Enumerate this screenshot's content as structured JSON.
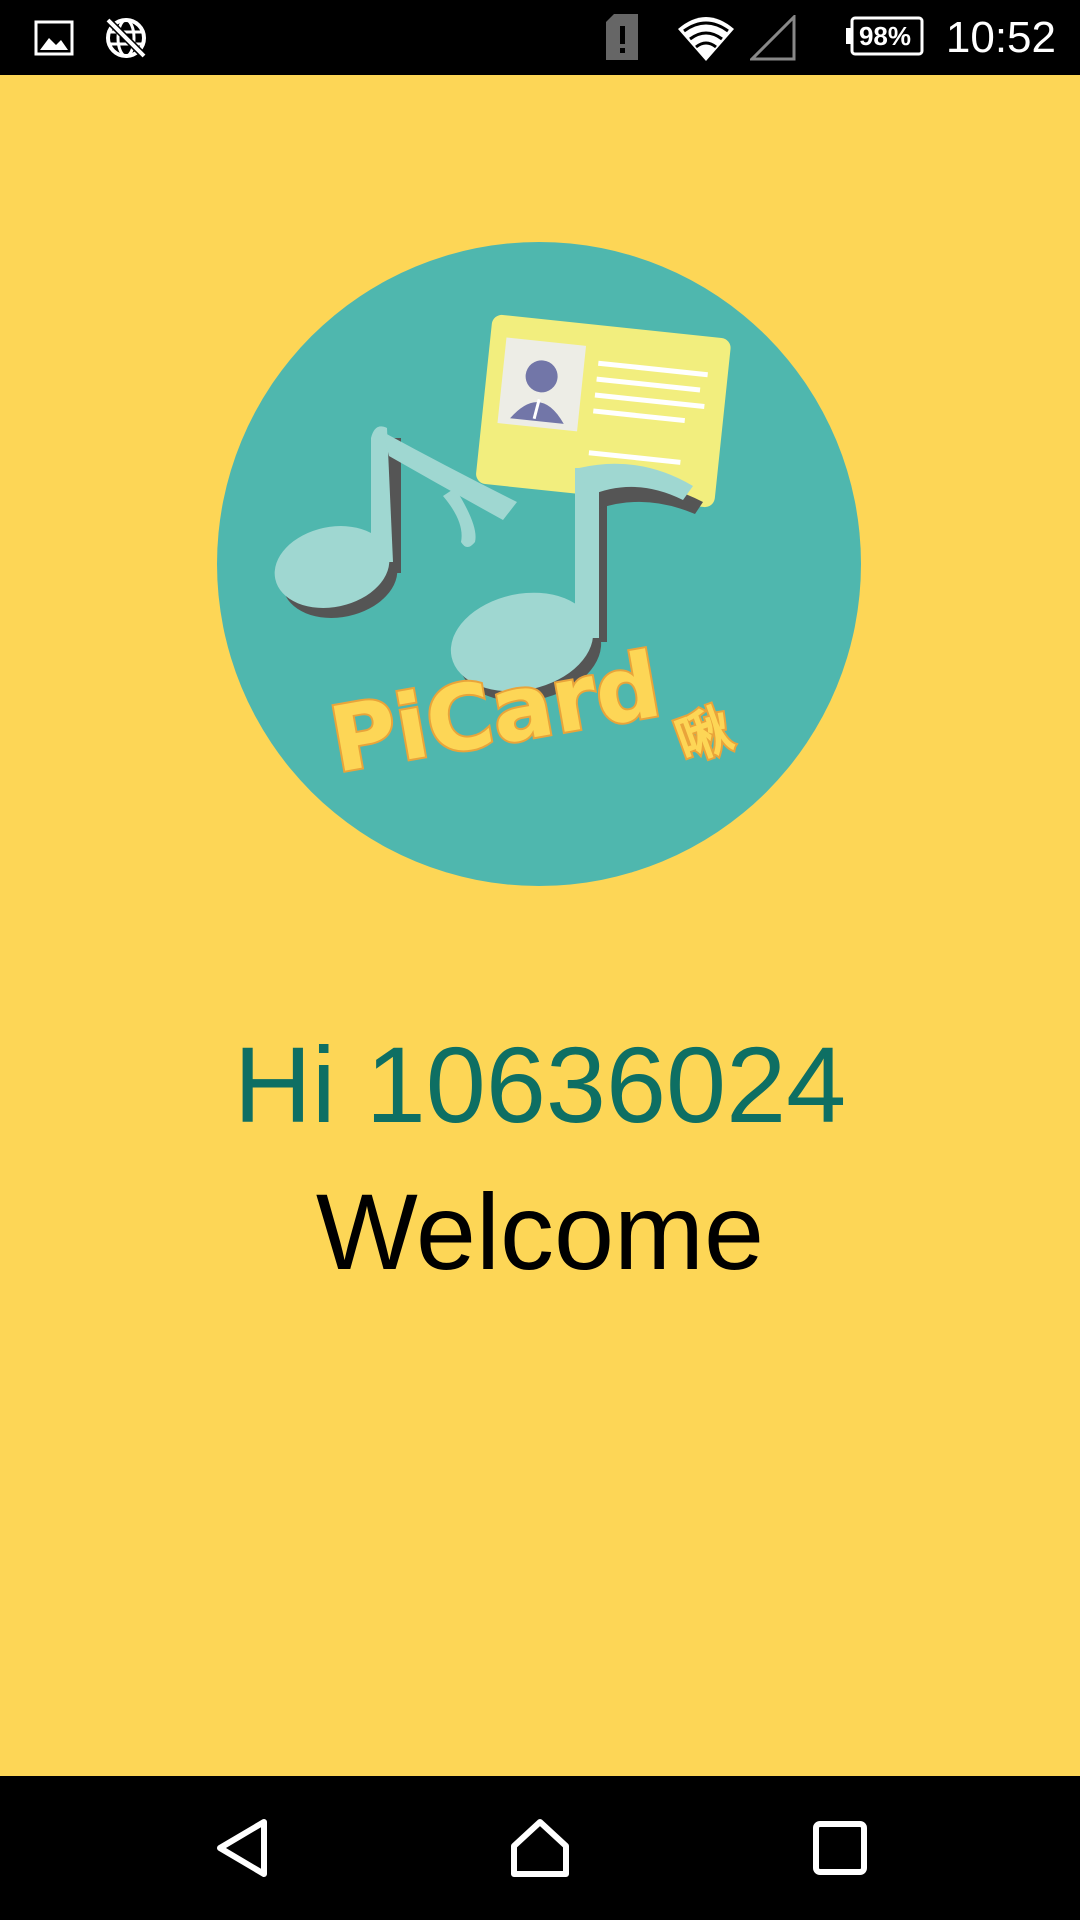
{
  "status_bar": {
    "time": "10:52",
    "battery_percent": "98%",
    "icons": [
      "image-notification-icon",
      "no-network-icon",
      "sim-alert-icon",
      "wifi-icon",
      "cell-signal-icon",
      "battery-icon"
    ]
  },
  "logo": {
    "icon": "picard-logo",
    "brand_text": "PiCard",
    "brand_suffix": "啾",
    "colors": {
      "circle": "#4FB7AE",
      "notes": "#9FD7D1",
      "card": "#F2EE7E",
      "text": "#FDD656"
    }
  },
  "main": {
    "greeting": "Hi 10636024",
    "welcome": "Welcome"
  },
  "nav_bar": {
    "icons": [
      "back-icon",
      "home-icon",
      "recents-icon"
    ]
  },
  "colors": {
    "background": "#FDD656",
    "greeting": "#0E6F63",
    "bars": "#000000"
  }
}
